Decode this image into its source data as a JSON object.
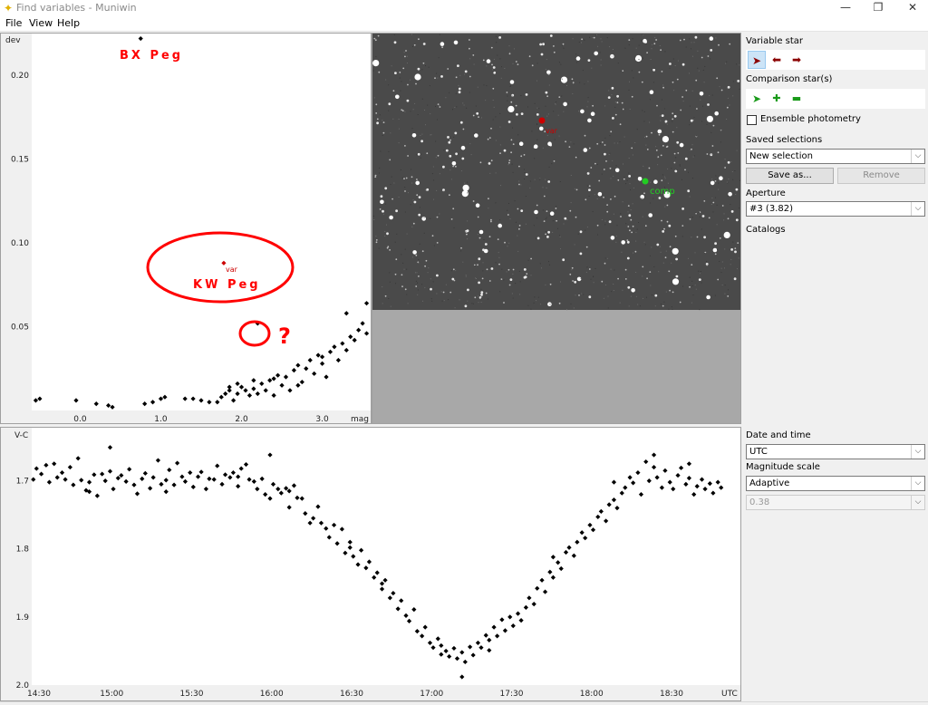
{
  "window": {
    "title": "Find variables - Muniwin",
    "minimize": "—",
    "maximize": "❐",
    "close": "✕",
    "icon": "star-sparkle-icon"
  },
  "menu": {
    "file": "File",
    "view": "View",
    "help": "Help"
  },
  "colors": {
    "annotation_red": "#ff0000",
    "var_marker": "#cc0000",
    "comp_marker": "#22cc22",
    "toolbar_red": "#8b0000",
    "toolbar_green": "#1a9a1a"
  },
  "annotations": {
    "bx_peg": "BX Peg",
    "kw_peg": "KW Peg",
    "question": "?",
    "var_label": "var"
  },
  "image": {
    "var_label": "var",
    "comp_label": "comp"
  },
  "sidebar": {
    "variable_star": "Variable star",
    "variable_tools": [
      "select-arrow-icon",
      "left-arrow-icon",
      "right-arrow-icon"
    ],
    "comparison_stars": "Comparison star(s)",
    "comparison_tools": [
      "select-arrow-icon",
      "add-star-icon",
      "remove-star-icon"
    ],
    "ensemble": "Ensemble photometry",
    "ensemble_checked": false,
    "saved_selections": "Saved selections",
    "saved_value": "New selection",
    "save_as": "Save as...",
    "remove": "Remove",
    "aperture": "Aperture",
    "aperture_value": "#3 (3.82)",
    "catalogs": "Catalogs"
  },
  "lc_controls": {
    "date_time": "Date and time",
    "date_value": "UTC",
    "mag_scale": "Magnitude scale",
    "mag_value": "Adaptive",
    "mag_range": "0.38"
  },
  "chart_data": [
    {
      "type": "scatter",
      "title": "",
      "xlabel": "mag",
      "ylabel": "dev",
      "xlim": [
        -0.6,
        3.6
      ],
      "ylim": [
        0.0,
        0.225
      ],
      "x_ticks": [
        "0.0",
        "1.0",
        "2.0",
        "3.0"
      ],
      "x_tick_values": [
        0.0,
        1.0,
        2.0,
        3.0
      ],
      "y_ticks": [
        "0.20",
        "0.15",
        "0.10",
        "0.05"
      ],
      "y_tick_values": [
        0.2,
        0.15,
        0.1,
        0.05
      ],
      "grid": false,
      "points": [
        [
          -0.55,
          0.006
        ],
        [
          -0.5,
          0.007
        ],
        [
          -0.05,
          0.006
        ],
        [
          0.2,
          0.004
        ],
        [
          0.35,
          0.003
        ],
        [
          0.4,
          0.002
        ],
        [
          0.8,
          0.004
        ],
        [
          0.9,
          0.005
        ],
        [
          1.0,
          0.007
        ],
        [
          1.05,
          0.008
        ],
        [
          1.3,
          0.007
        ],
        [
          1.4,
          0.007
        ],
        [
          1.5,
          0.006
        ],
        [
          1.6,
          0.005
        ],
        [
          1.7,
          0.005
        ],
        [
          1.75,
          0.008
        ],
        [
          1.8,
          0.01
        ],
        [
          1.85,
          0.012
        ],
        [
          1.9,
          0.006
        ],
        [
          1.95,
          0.01
        ],
        [
          2.0,
          0.014
        ],
        [
          2.05,
          0.012
        ],
        [
          2.1,
          0.009
        ],
        [
          2.15,
          0.013
        ],
        [
          2.2,
          0.01
        ],
        [
          2.25,
          0.016
        ],
        [
          2.3,
          0.012
        ],
        [
          2.35,
          0.018
        ],
        [
          2.4,
          0.009
        ],
        [
          2.45,
          0.021
        ],
        [
          2.5,
          0.015
        ],
        [
          2.55,
          0.02
        ],
        [
          2.6,
          0.012
        ],
        [
          2.65,
          0.024
        ],
        [
          2.7,
          0.027
        ],
        [
          2.75,
          0.017
        ],
        [
          2.8,
          0.025
        ],
        [
          2.85,
          0.03
        ],
        [
          2.9,
          0.022
        ],
        [
          2.95,
          0.033
        ],
        [
          3.0,
          0.028
        ],
        [
          3.05,
          0.02
        ],
        [
          3.1,
          0.035
        ],
        [
          3.15,
          0.038
        ],
        [
          3.2,
          0.03
        ],
        [
          3.25,
          0.04
        ],
        [
          3.3,
          0.036
        ],
        [
          3.35,
          0.044
        ],
        [
          3.4,
          0.042
        ],
        [
          3.45,
          0.048
        ],
        [
          3.5,
          0.052
        ],
        [
          3.3,
          0.058
        ],
        [
          3.0,
          0.032
        ],
        [
          2.7,
          0.015
        ],
        [
          1.95,
          0.016
        ],
        [
          2.15,
          0.018
        ],
        [
          1.85,
          0.014
        ],
        [
          2.4,
          0.019
        ],
        [
          3.55,
          0.064
        ],
        [
          3.55,
          0.046
        ],
        [
          2.2,
          0.052
        ],
        [
          0.75,
          0.222
        ]
      ],
      "highlighted_point": [
        1.78,
        0.088
      ]
    },
    {
      "type": "scatter",
      "title": "",
      "xlabel": "UTC",
      "ylabel": "V-C",
      "xlim": [
        14.5,
        18.84
      ],
      "ylim": [
        2.0,
        1.63
      ],
      "x_ticks": [
        "14:30",
        "15:00",
        "15:30",
        "16:00",
        "16:30",
        "17:00",
        "17:30",
        "18:00",
        "18:30"
      ],
      "x_tick_values": [
        14.5,
        15.0,
        15.5,
        16.0,
        16.5,
        17.0,
        17.5,
        18.0,
        18.5
      ],
      "y_ticks": [
        "1.7",
        "1.8",
        "1.9",
        "2.0"
      ],
      "y_tick_values": [
        1.7,
        1.8,
        1.9,
        2.0
      ],
      "grid": false,
      "points": [
        [
          14.51,
          1.698
        ],
        [
          14.53,
          1.682
        ],
        [
          14.56,
          1.69
        ],
        [
          14.59,
          1.677
        ],
        [
          14.61,
          1.702
        ],
        [
          14.64,
          1.675
        ],
        [
          14.66,
          1.695
        ],
        [
          14.69,
          1.688
        ],
        [
          14.71,
          1.698
        ],
        [
          14.74,
          1.68
        ],
        [
          14.76,
          1.706
        ],
        [
          14.79,
          1.667
        ],
        [
          14.81,
          1.699
        ],
        [
          14.84,
          1.714
        ],
        [
          14.86,
          1.702
        ],
        [
          14.89,
          1.691
        ],
        [
          14.91,
          1.722
        ],
        [
          14.94,
          1.69
        ],
        [
          14.96,
          1.7
        ],
        [
          14.99,
          1.686
        ],
        [
          15.01,
          1.712
        ],
        [
          15.04,
          1.696
        ],
        [
          15.06,
          1.692
        ],
        [
          15.09,
          1.701
        ],
        [
          15.11,
          1.683
        ],
        [
          15.14,
          1.706
        ],
        [
          15.16,
          1.719
        ],
        [
          15.19,
          1.697
        ],
        [
          15.21,
          1.689
        ],
        [
          15.24,
          1.711
        ],
        [
          15.26,
          1.695
        ],
        [
          15.29,
          1.67
        ],
        [
          15.31,
          1.705
        ],
        [
          15.34,
          1.699
        ],
        [
          15.36,
          1.684
        ],
        [
          15.39,
          1.706
        ],
        [
          15.41,
          1.674
        ],
        [
          15.44,
          1.694
        ],
        [
          15.46,
          1.701
        ],
        [
          15.49,
          1.688
        ],
        [
          15.51,
          1.709
        ],
        [
          15.54,
          1.694
        ],
        [
          15.56,
          1.687
        ],
        [
          15.59,
          1.712
        ],
        [
          15.61,
          1.697
        ],
        [
          15.64,
          1.698
        ],
        [
          15.66,
          1.678
        ],
        [
          15.69,
          1.705
        ],
        [
          15.71,
          1.691
        ],
        [
          15.74,
          1.695
        ],
        [
          15.76,
          1.688
        ],
        [
          15.79,
          1.708
        ],
        [
          15.81,
          1.682
        ],
        [
          15.84,
          1.676
        ],
        [
          15.86,
          1.698
        ],
        [
          15.89,
          1.701
        ],
        [
          15.91,
          1.712
        ],
        [
          15.94,
          1.697
        ],
        [
          15.96,
          1.72
        ],
        [
          15.99,
          1.726
        ],
        [
          16.01,
          1.705
        ],
        [
          16.04,
          1.712
        ],
        [
          16.06,
          1.718
        ],
        [
          16.09,
          1.711
        ],
        [
          16.11,
          1.739
        ],
        [
          16.14,
          1.707
        ],
        [
          16.16,
          1.725
        ],
        [
          16.19,
          1.726
        ],
        [
          16.21,
          1.748
        ],
        [
          16.24,
          1.762
        ],
        [
          16.26,
          1.755
        ],
        [
          16.29,
          1.738
        ],
        [
          16.31,
          1.762
        ],
        [
          16.34,
          1.77
        ],
        [
          16.36,
          1.783
        ],
        [
          16.39,
          1.765
        ],
        [
          16.41,
          1.792
        ],
        [
          16.44,
          1.771
        ],
        [
          16.46,
          1.806
        ],
        [
          16.49,
          1.798
        ],
        [
          16.51,
          1.811
        ],
        [
          16.54,
          1.823
        ],
        [
          16.56,
          1.802
        ],
        [
          16.59,
          1.828
        ],
        [
          16.61,
          1.819
        ],
        [
          16.64,
          1.842
        ],
        [
          16.66,
          1.835
        ],
        [
          16.69,
          1.859
        ],
        [
          16.71,
          1.846
        ],
        [
          16.74,
          1.872
        ],
        [
          16.76,
          1.865
        ],
        [
          16.79,
          1.888
        ],
        [
          16.81,
          1.876
        ],
        [
          16.84,
          1.898
        ],
        [
          16.86,
          1.906
        ],
        [
          16.89,
          1.889
        ],
        [
          16.91,
          1.921
        ],
        [
          16.94,
          1.928
        ],
        [
          16.96,
          1.915
        ],
        [
          16.99,
          1.938
        ],
        [
          17.01,
          1.945
        ],
        [
          17.04,
          1.932
        ],
        [
          17.06,
          1.955
        ],
        [
          17.09,
          1.95
        ],
        [
          17.11,
          1.958
        ],
        [
          17.14,
          1.946
        ],
        [
          17.16,
          1.961
        ],
        [
          17.19,
          1.952
        ],
        [
          17.21,
          1.966
        ],
        [
          17.24,
          1.944
        ],
        [
          17.26,
          1.956
        ],
        [
          17.29,
          1.938
        ],
        [
          17.31,
          1.945
        ],
        [
          17.34,
          1.927
        ],
        [
          17.36,
          1.934
        ],
        [
          17.39,
          1.915
        ],
        [
          17.41,
          1.928
        ],
        [
          17.44,
          1.904
        ],
        [
          17.46,
          1.92
        ],
        [
          17.49,
          1.9
        ],
        [
          17.51,
          1.913
        ],
        [
          17.54,
          1.895
        ],
        [
          17.56,
          1.905
        ],
        [
          17.59,
          1.886
        ],
        [
          17.61,
          1.872
        ],
        [
          17.64,
          1.881
        ],
        [
          17.66,
          1.858
        ],
        [
          17.69,
          1.846
        ],
        [
          17.71,
          1.863
        ],
        [
          17.74,
          1.834
        ],
        [
          17.76,
          1.842
        ],
        [
          17.79,
          1.82
        ],
        [
          17.81,
          1.829
        ],
        [
          17.84,
          1.805
        ],
        [
          17.86,
          1.798
        ],
        [
          17.89,
          1.81
        ],
        [
          17.91,
          1.79
        ],
        [
          17.94,
          1.776
        ],
        [
          17.96,
          1.784
        ],
        [
          17.99,
          1.765
        ],
        [
          18.01,
          1.772
        ],
        [
          18.04,
          1.753
        ],
        [
          18.06,
          1.745
        ],
        [
          18.09,
          1.759
        ],
        [
          18.11,
          1.735
        ],
        [
          18.14,
          1.728
        ],
        [
          18.16,
          1.74
        ],
        [
          18.19,
          1.718
        ],
        [
          18.21,
          1.71
        ],
        [
          18.24,
          1.695
        ],
        [
          18.26,
          1.703
        ],
        [
          18.29,
          1.688
        ],
        [
          18.31,
          1.72
        ],
        [
          18.34,
          1.672
        ],
        [
          18.36,
          1.7
        ],
        [
          18.39,
          1.68
        ],
        [
          18.41,
          1.695
        ],
        [
          18.44,
          1.71
        ],
        [
          18.46,
          1.685
        ],
        [
          18.49,
          1.702
        ],
        [
          18.51,
          1.712
        ],
        [
          18.54,
          1.692
        ],
        [
          18.56,
          1.681
        ],
        [
          18.59,
          1.705
        ],
        [
          18.61,
          1.696
        ],
        [
          18.64,
          1.72
        ],
        [
          18.66,
          1.708
        ],
        [
          18.69,
          1.698
        ],
        [
          18.71,
          1.712
        ],
        [
          18.74,
          1.704
        ],
        [
          18.76,
          1.718
        ],
        [
          18.79,
          1.702
        ],
        [
          18.81,
          1.71
        ],
        [
          14.99,
          1.651
        ],
        [
          15.99,
          1.662
        ],
        [
          18.39,
          1.662
        ],
        [
          17.19,
          1.988
        ],
        [
          16.49,
          1.79
        ],
        [
          16.69,
          1.851
        ],
        [
          17.06,
          1.942
        ],
        [
          17.36,
          1.949
        ],
        [
          18.14,
          1.702
        ],
        [
          18.61,
          1.675
        ],
        [
          15.34,
          1.716
        ],
        [
          15.79,
          1.694
        ],
        [
          14.86,
          1.716
        ],
        [
          17.76,
          1.812
        ],
        [
          16.11,
          1.715
        ]
      ]
    }
  ]
}
